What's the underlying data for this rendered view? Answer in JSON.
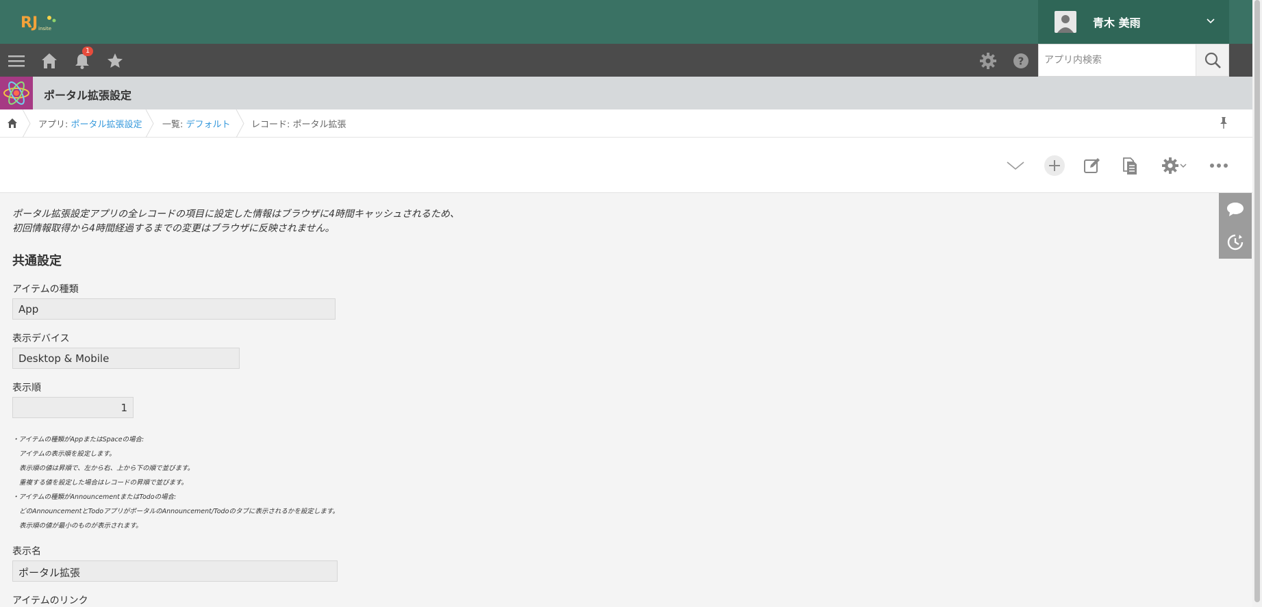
{
  "header": {
    "logo_text": "RJ",
    "user_name": "青木 美雨"
  },
  "gnav": {
    "notification_count": "1",
    "search_placeholder": "アプリ内検索"
  },
  "app": {
    "title": "ポータル拡張設定"
  },
  "breadcrumb": {
    "app_prefix": "アプリ: ",
    "app_link": "ポータル拡張設定",
    "view_prefix": "一覧: ",
    "view_link": "デフォルト",
    "record": "レコード: ポータル拡張"
  },
  "notice": {
    "line1": "ポータル拡張設定アプリの全レコードの項目に設定した情報はブラウザに4時間キャッシュされるため、",
    "line2": "初回情報取得から4時間経過するまでの変更はブラウザに反映されません。"
  },
  "section": {
    "title": "共通設定"
  },
  "fields": {
    "item_type_label": "アイテムの種類",
    "item_type_value": "App",
    "device_label": "表示デバイス",
    "device_value": "Desktop & Mobile",
    "order_label": "表示順",
    "order_value": "1",
    "display_name_label": "表示名",
    "display_name_value": "ポータル拡張",
    "link_label": "アイテムのリンク"
  },
  "help": {
    "l1": "・アイテムの種類がAppまたはSpaceの場合:",
    "l2": "アイテムの表示順を設定します。",
    "l3": "表示順の値は昇順で、左から右、上から下の順で並びます。",
    "l4": "重複する値を設定した場合はレコードの昇順で並びます。",
    "l5": "・アイテムの種類がAnnouncementまたはTodoの場合:",
    "l6": "どのAnnouncementとTodoアプリがポータルのAnnouncement/Todoのタブに表示されるかを設定します。",
    "l7": "表示順の値が最小のものが表示されます。"
  },
  "colors": {
    "header": "#3a7264",
    "gnav": "#4b4b4b",
    "app_icon": "#b03b81",
    "link": "#3498db"
  }
}
